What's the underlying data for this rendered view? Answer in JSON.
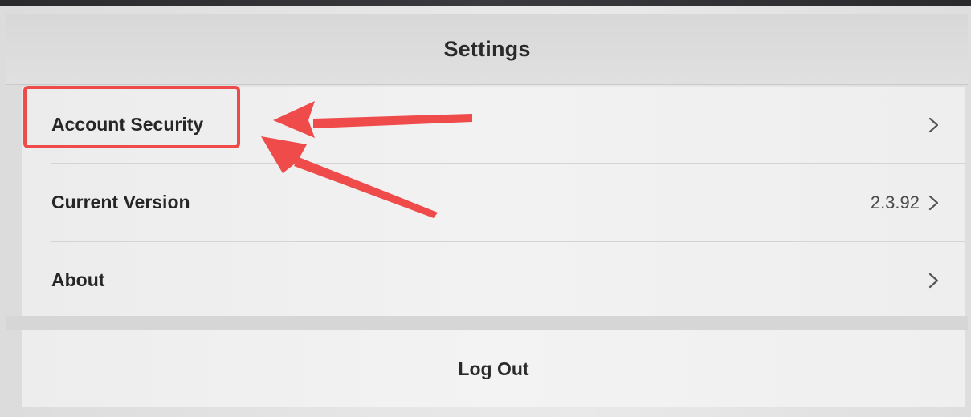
{
  "header": {
    "title": "Settings"
  },
  "settings_list": {
    "items": [
      {
        "label": "Account Security",
        "value": "",
        "chevron_icon": "chevron-right-icon"
      },
      {
        "label": "Current Version",
        "value": "2.3.92",
        "chevron_icon": "chevron-right-icon"
      },
      {
        "label": "About",
        "value": "",
        "chevron_icon": "chevron-right-icon"
      }
    ]
  },
  "logout": {
    "label": "Log Out"
  },
  "annotation": {
    "highlighted_item": "Account Security",
    "color": "#ef4b4b"
  },
  "colors": {
    "background": "#e6e6e6",
    "text": "#262626",
    "annotation": "#ef4b4b"
  }
}
